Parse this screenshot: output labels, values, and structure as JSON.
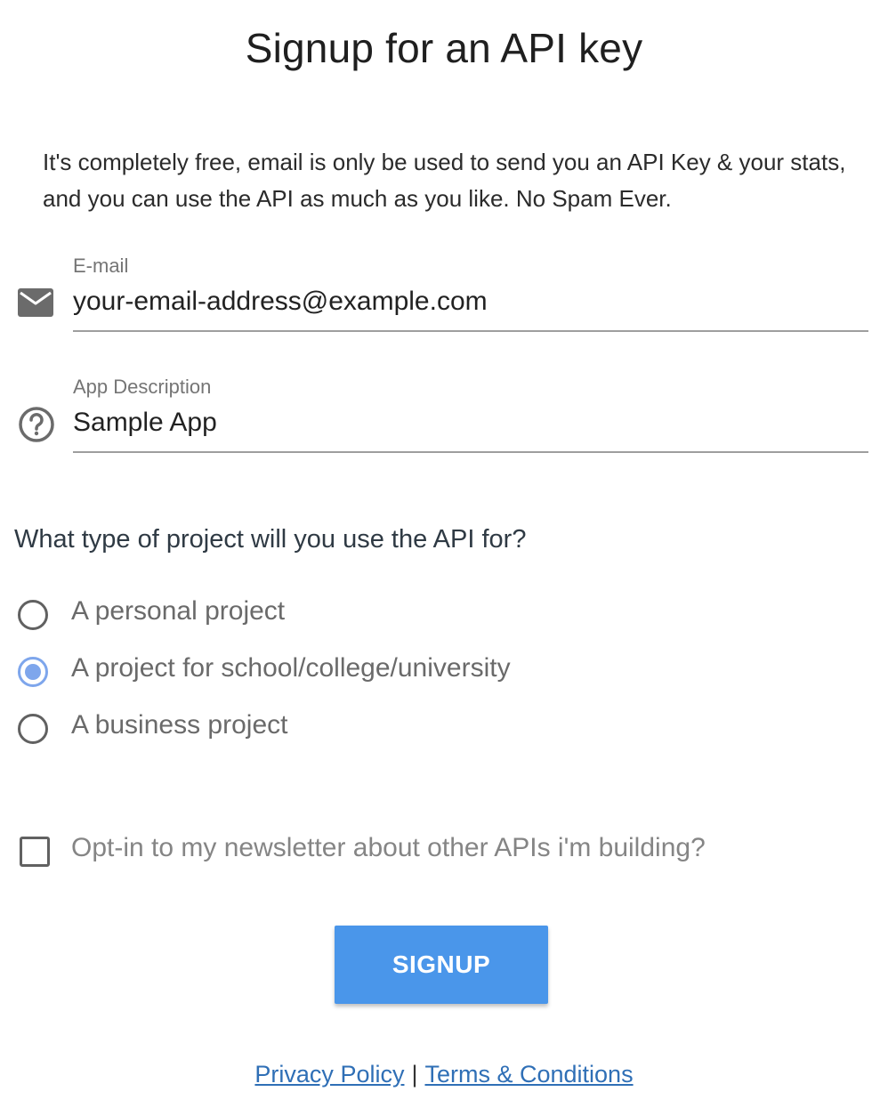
{
  "title": "Signup for an API key",
  "intro": "It's completely free, email is only be used to send you an API Key & your stats, and you can use the API as much as you like. No Spam Ever.",
  "email_field": {
    "label": "E-mail",
    "value": "your-email-address@example.com",
    "icon": "mail-icon"
  },
  "description_field": {
    "label": "App Description",
    "value": "Sample App",
    "icon": "help-circle-icon"
  },
  "project_question": "What type of project will you use the API for?",
  "project_options": [
    {
      "label": "A personal project",
      "selected": false
    },
    {
      "label": "A project for school/college/university",
      "selected": true
    },
    {
      "label": "A business project",
      "selected": false
    }
  ],
  "newsletter": {
    "label": "Opt-in to my newsletter about other APIs i'm building?",
    "checked": false
  },
  "signup_button": "SIGNUP",
  "footer": {
    "privacy": "Privacy Policy",
    "separator": "|",
    "terms": "Terms & Conditions"
  },
  "colors": {
    "accent": "#4a96ea",
    "radio_selected": "#7ea6ec",
    "link": "#2f6fb6"
  }
}
